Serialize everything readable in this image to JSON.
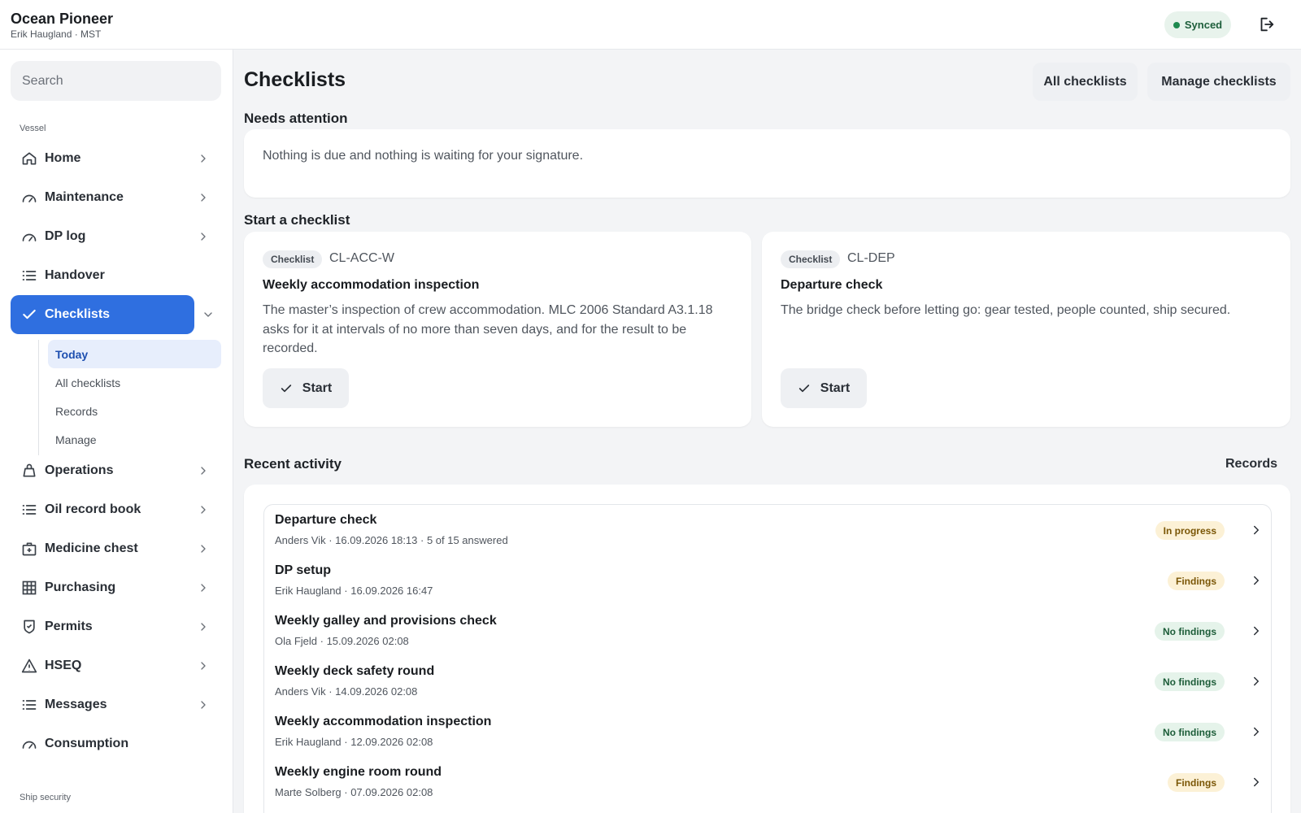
{
  "header": {
    "vessel_name": "Ocean Pioneer",
    "user_line": "Erik Haugland · MST",
    "sync_status": "Synced"
  },
  "sidebar": {
    "search_placeholder": "Search",
    "section_vessel": "Vessel",
    "section_ship_security": "Ship security",
    "items": [
      {
        "label": "Home",
        "icon": "home-icon"
      },
      {
        "label": "Maintenance",
        "icon": "gauge-icon"
      },
      {
        "label": "DP log",
        "icon": "gauge-icon"
      },
      {
        "label": "Handover",
        "icon": "list-icon"
      },
      {
        "label": "Checklists",
        "icon": "check-icon",
        "active": true
      },
      {
        "label": "Operations",
        "icon": "bag-icon"
      },
      {
        "label": "Oil record book",
        "icon": "list-icon"
      },
      {
        "label": "Medicine chest",
        "icon": "medkit-icon"
      },
      {
        "label": "Purchasing",
        "icon": "grid-icon"
      },
      {
        "label": "Permits",
        "icon": "shield-check-icon"
      },
      {
        "label": "HSEQ",
        "icon": "warning-icon"
      },
      {
        "label": "Messages",
        "icon": "list-icon"
      },
      {
        "label": "Consumption",
        "icon": "gauge-icon"
      }
    ],
    "checklists_sub": [
      "Today",
      "All checklists",
      "Records",
      "Manage"
    ]
  },
  "main": {
    "title": "Checklists",
    "btn_all": "All checklists",
    "btn_manage": "Manage checklists",
    "needs_attention_title": "Needs attention",
    "needs_attention_text": "Nothing is due and nothing is waiting for your signature.",
    "start_title": "Start a checklist",
    "cards": [
      {
        "tag": "Checklist",
        "code": "CL-ACC-W",
        "title": "Weekly accommodation inspection",
        "desc_lines": [
          "The master’s inspection of crew accommodation. MLC 2006 Standard A3.1.18",
          "asks for it at intervals of no more than seven days, and for the result to be",
          "recorded."
        ],
        "start": "Start"
      },
      {
        "tag": "Checklist",
        "code": "CL-DEP",
        "title": "Departure check",
        "desc_lines": [
          "The bridge check before letting go: gear tested, people counted, ship secured."
        ],
        "start": "Start"
      }
    ],
    "recent_title": "Recent activity",
    "records_link": "Records",
    "activity": [
      {
        "title": "Departure check",
        "meta": "Anders Vik · 16.09.2026 18:13 · 5 of 15 answered",
        "status": "In progress",
        "tone": "amber"
      },
      {
        "title": "DP setup",
        "meta": "Erik Haugland · 16.09.2026 16:47",
        "status": "Findings",
        "tone": "amber"
      },
      {
        "title": "Weekly galley and provisions check",
        "meta": "Ola Fjeld · 15.09.2026 02:08",
        "status": "No findings",
        "tone": "green"
      },
      {
        "title": "Weekly deck safety round",
        "meta": "Anders Vik · 14.09.2026 02:08",
        "status": "No findings",
        "tone": "green"
      },
      {
        "title": "Weekly accommodation inspection",
        "meta": "Erik Haugland · 12.09.2026 02:08",
        "status": "No findings",
        "tone": "green"
      },
      {
        "title": "Weekly engine room round",
        "meta": "Marte Solberg · 07.09.2026 02:08",
        "status": "Findings",
        "tone": "amber"
      }
    ]
  },
  "colors": {
    "accent": "#2f6fe0",
    "synced_bg": "#e8f3ec",
    "amber_badge": "#fcf1d6",
    "green_badge": "#e5f3ea"
  }
}
